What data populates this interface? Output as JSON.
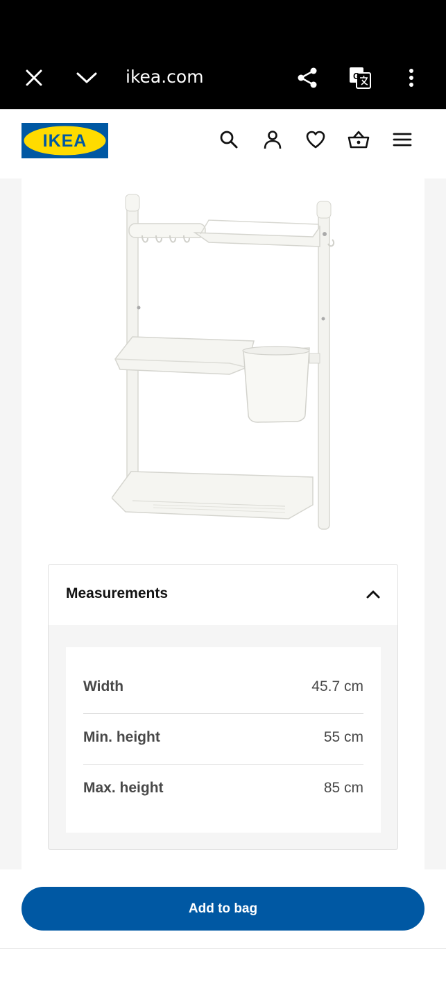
{
  "browser": {
    "url": "ikea.com",
    "icons": [
      "close-icon",
      "chevron-down-icon",
      "share-icon",
      "translate-icon",
      "more-vert-icon"
    ]
  },
  "header": {
    "logo_text": "IKEA",
    "icons": [
      "search-icon",
      "account-icon",
      "heart-icon",
      "basket-icon",
      "menu-icon"
    ],
    "brand_blue": "#0058a3",
    "brand_yellow": "#ffdb00"
  },
  "measurements": {
    "title": "Measurements",
    "expanded": true,
    "rows": [
      {
        "label": "Width",
        "value": "45.7 cm"
      },
      {
        "label": "Min. height",
        "value": "55 cm"
      },
      {
        "label": "Max. height",
        "value": "85 cm"
      }
    ]
  },
  "actions": {
    "add_to_bag_label": "Add to bag"
  }
}
